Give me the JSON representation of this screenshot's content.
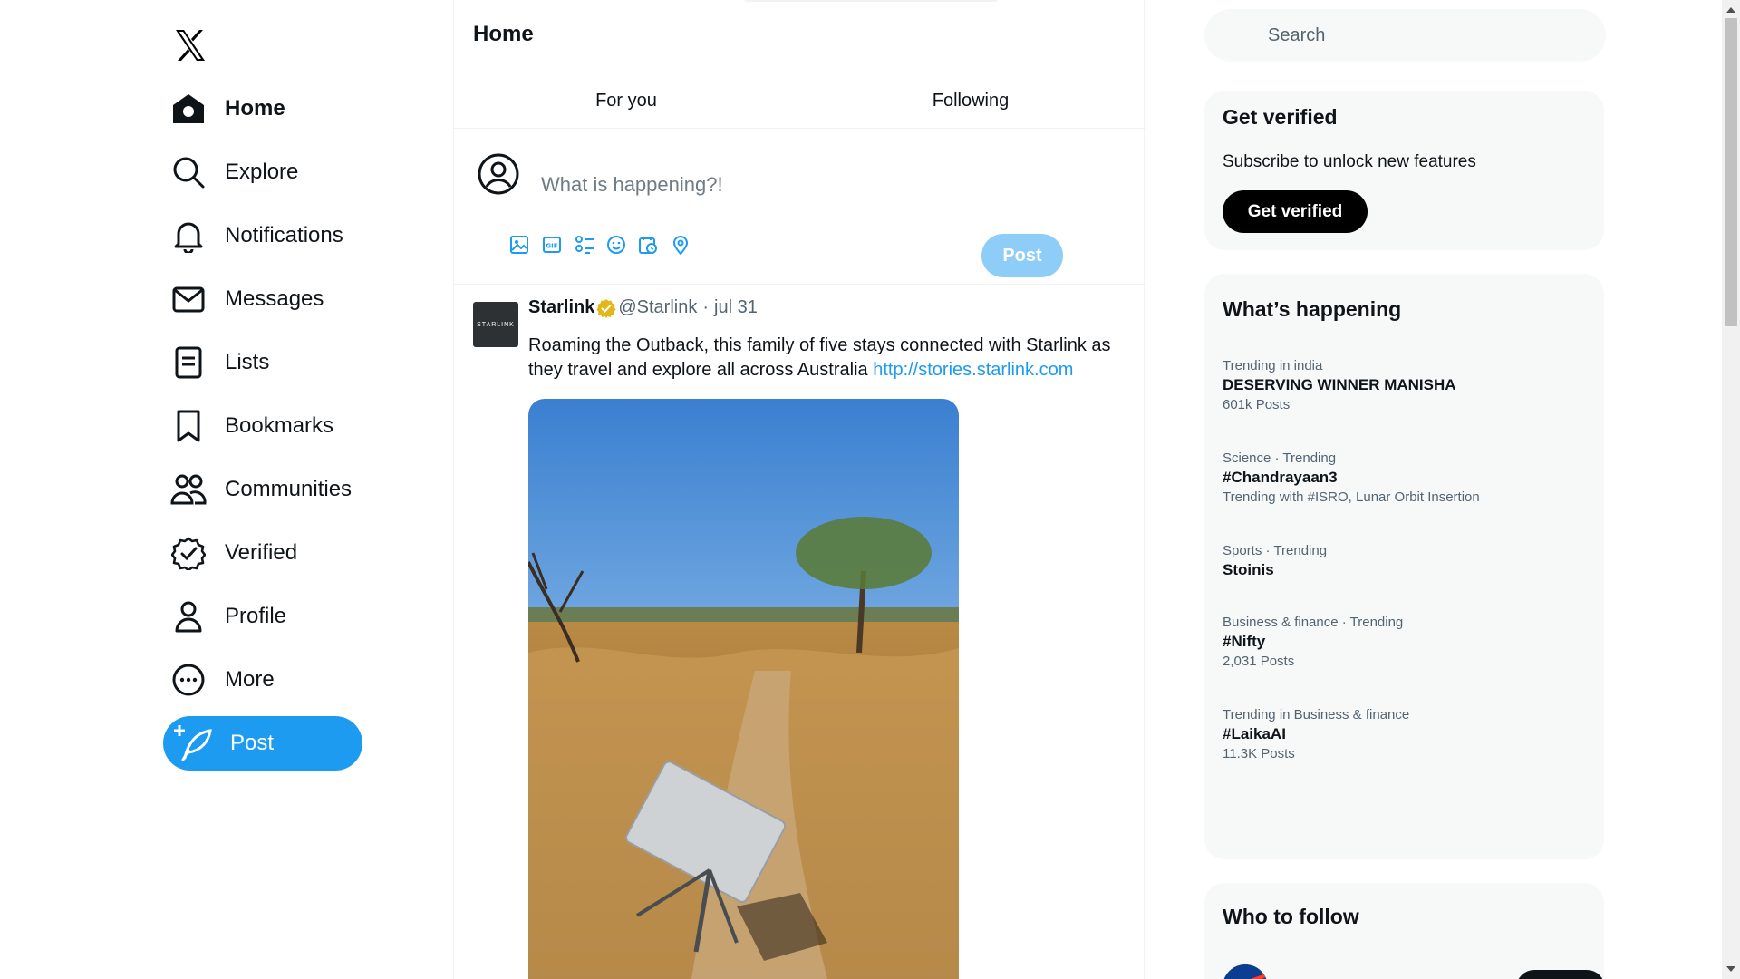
{
  "sidebar": {
    "logo": "x-logo-icon",
    "items": [
      {
        "label": "Home",
        "icon": "home-icon"
      },
      {
        "label": "Explore",
        "icon": "search-icon"
      },
      {
        "label": "Notifications",
        "icon": "bell-icon"
      },
      {
        "label": "Messages",
        "icon": "envelope-icon"
      },
      {
        "label": "Lists",
        "icon": "list-icon"
      },
      {
        "label": "Bookmarks",
        "icon": "bookmark-icon"
      },
      {
        "label": "Communities",
        "icon": "people-icon"
      },
      {
        "label": "Verified",
        "icon": "verified-badge-icon"
      },
      {
        "label": "Profile",
        "icon": "person-icon"
      },
      {
        "label": "More",
        "icon": "more-circle-icon"
      }
    ],
    "post_label": "Post"
  },
  "main": {
    "title": "Home",
    "tabs": [
      {
        "label": "For you"
      },
      {
        "label": "Following"
      }
    ],
    "composer": {
      "placeholder": "What is happening?!",
      "post_label": "Post",
      "tools": [
        "image-icon",
        "gif-icon",
        "poll-icon",
        "emoji-icon",
        "schedule-icon",
        "location-icon"
      ]
    },
    "tweet": {
      "avatar_text": "STARLINK",
      "name": "Starlink",
      "handle": "@Starlink",
      "separator": "·",
      "time": "jul 31",
      "text": "Roaming the Outback, this family of five stays connected with Starlink as they travel and explore all across Australia ",
      "link": "http://stories.starlink.com"
    }
  },
  "right": {
    "search_placeholder": "Search",
    "verified": {
      "title": "Get verified",
      "subtitle": "Subscribe to unlock new features",
      "button": "Get verified"
    },
    "trends": {
      "title": "What’s happening",
      "items": [
        {
          "meta": "Trending in india",
          "title": "DESERVING WINNER MANISHA",
          "sub": "601k Posts"
        },
        {
          "meta": "Science · Trending",
          "title": "#Chandrayaan3",
          "sub": "Trending with #ISRO, Lunar Orbit Insertion"
        },
        {
          "meta": "Sports · Trending",
          "title": "Stoinis",
          "sub": ""
        },
        {
          "meta": "Business & finance · Trending",
          "title": "#Nifty",
          "sub": "2,031 Posts"
        },
        {
          "meta": "Trending in Business & finance",
          "title": "#LaikaAI",
          "sub": "11.3K Posts"
        }
      ]
    },
    "follow": {
      "title": "Who to follow"
    }
  },
  "colors": {
    "accent": "#1d9bf0",
    "accent_disabled": "#8ecdf8",
    "text": "#0f1419",
    "muted": "#536471",
    "card_bg": "#f7f9f9"
  }
}
